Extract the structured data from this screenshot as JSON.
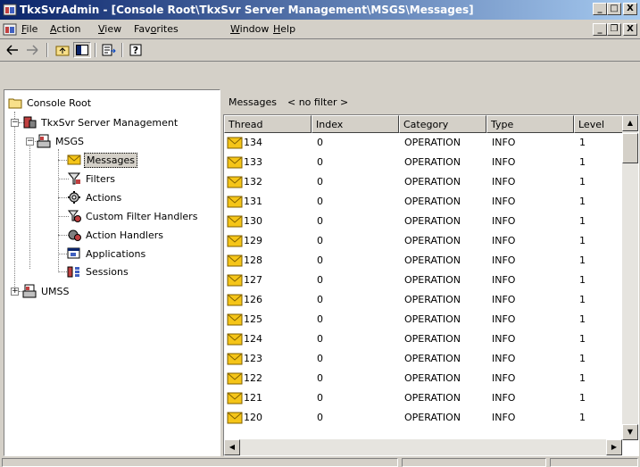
{
  "window": {
    "title": "TkxSvrAdmin - [Console Root\\TkxSvr Server Management\\MSGS\\Messages]",
    "min_label": "_",
    "max_label": "□",
    "close_label": "X",
    "child_min_label": "_",
    "child_restore_label": "❐",
    "child_close_label": "X"
  },
  "menu": {
    "file": {
      "u": "F",
      "rest": "ile"
    },
    "action": {
      "u": "A",
      "rest": "ction"
    },
    "view": {
      "u": "V",
      "rest": "iew"
    },
    "favorites": {
      "pre": "Fav",
      "u": "o",
      "rest": "rites"
    },
    "window": {
      "u": "W",
      "rest": "indow"
    },
    "help": {
      "u": "H",
      "rest": "elp"
    }
  },
  "tree": {
    "console_root": "Console Root",
    "server_mgmt": "TkxSvr Server Management",
    "msgs": "MSGS",
    "messages": "Messages",
    "filters": "Filters",
    "actions": "Actions",
    "custom_filter_handlers": "Custom Filter Handlers",
    "action_handlers": "Action Handlers",
    "applications": "Applications",
    "sessions": "Sessions",
    "umss": "UMSS"
  },
  "list": {
    "header_title": "Messages",
    "filter_text": "< no filter >",
    "columns": [
      "Thread",
      "Index",
      "Category",
      "Type",
      "Level"
    ],
    "rows": [
      [
        "134",
        "0",
        "OPERATION",
        "INFO",
        "1"
      ],
      [
        "133",
        "0",
        "OPERATION",
        "INFO",
        "1"
      ],
      [
        "132",
        "0",
        "OPERATION",
        "INFO",
        "1"
      ],
      [
        "131",
        "0",
        "OPERATION",
        "INFO",
        "1"
      ],
      [
        "130",
        "0",
        "OPERATION",
        "INFO",
        "1"
      ],
      [
        "129",
        "0",
        "OPERATION",
        "INFO",
        "1"
      ],
      [
        "128",
        "0",
        "OPERATION",
        "INFO",
        "1"
      ],
      [
        "127",
        "0",
        "OPERATION",
        "INFO",
        "1"
      ],
      [
        "126",
        "0",
        "OPERATION",
        "INFO",
        "1"
      ],
      [
        "125",
        "0",
        "OPERATION",
        "INFO",
        "1"
      ],
      [
        "124",
        "0",
        "OPERATION",
        "INFO",
        "1"
      ],
      [
        "123",
        "0",
        "OPERATION",
        "INFO",
        "1"
      ],
      [
        "122",
        "0",
        "OPERATION",
        "INFO",
        "1"
      ],
      [
        "121",
        "0",
        "OPERATION",
        "INFO",
        "1"
      ],
      [
        "120",
        "0",
        "OPERATION",
        "INFO",
        "1"
      ]
    ]
  },
  "icons": {
    "app": "mmc-app-icon",
    "back": "back-arrow-icon",
    "forward": "forward-arrow-icon",
    "up": "up-folder-icon",
    "show_tree": "show-hide-tree-icon",
    "export": "export-list-icon",
    "help": "help-icon",
    "message": "envelope-icon"
  },
  "colors": {
    "title_start": "#0a246a",
    "title_end": "#a6caf0",
    "face": "#d4d0c8",
    "envelope": "#f5c518"
  }
}
